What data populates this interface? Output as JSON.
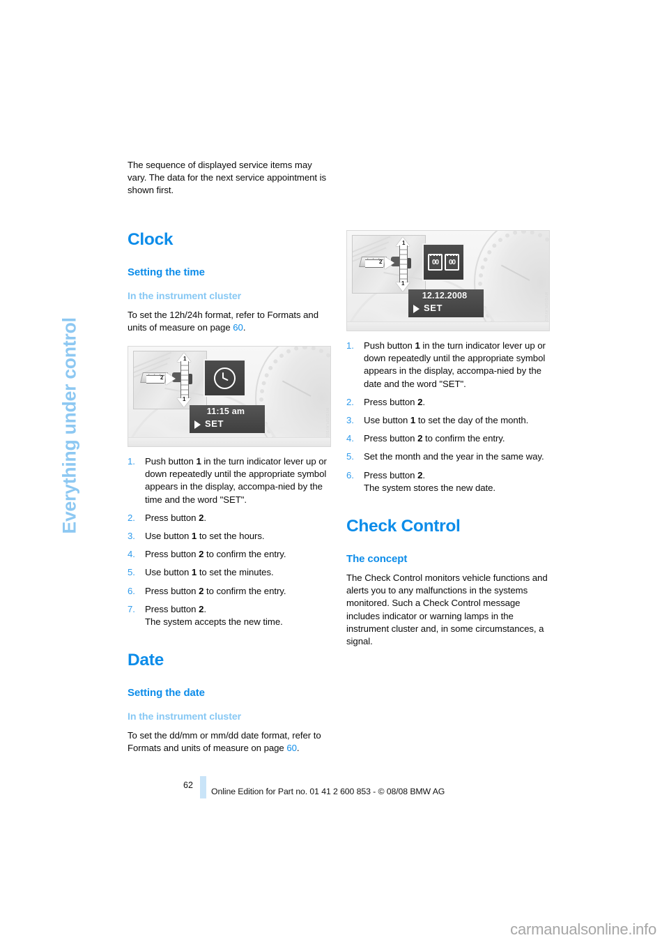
{
  "chapter_tab": {
    "label": "Everything under control"
  },
  "colors": {
    "heading_blue": "#0C8CE9",
    "subheading_light_blue": "#87C8F4",
    "chapter_tab_blue": "#8DC8F2",
    "footer_bar_blue": "#C9E4F8"
  },
  "left_column": {
    "intro_paragraph": "The sequence of displayed service items may vary. The data for the next service appointment is shown first.",
    "clock_heading": "Clock",
    "setting_the_time_heading": "Setting the time",
    "instrument_cluster_heading": "In the instrument cluster",
    "format_paragraph_before": "To set the 12h/24h format, refer to Formats and units of measure on page ",
    "format_page_ref": "60",
    "format_paragraph_after": ".",
    "figure": {
      "caption_credit": "MYDISPLAY001",
      "display_value": "11:15 am",
      "display_set_label": "SET",
      "arrow_label_1": "1",
      "arrow_label_2": "2",
      "icon": "clock-icon"
    },
    "steps": [
      {
        "text_parts": [
          {
            "t": "Push button "
          },
          {
            "t": "1",
            "b": true
          },
          {
            "t": " in the turn indicator lever up or down repeatedly until the appropriate symbol appears in the display, accompa‑nied by the time and the word \"SET\"."
          }
        ]
      },
      {
        "text_parts": [
          {
            "t": "Press button "
          },
          {
            "t": "2",
            "b": true
          },
          {
            "t": "."
          }
        ]
      },
      {
        "text_parts": [
          {
            "t": "Use button "
          },
          {
            "t": "1",
            "b": true
          },
          {
            "t": " to set the hours."
          }
        ]
      },
      {
        "text_parts": [
          {
            "t": "Press button "
          },
          {
            "t": "2",
            "b": true
          },
          {
            "t": " to confirm the entry."
          }
        ]
      },
      {
        "text_parts": [
          {
            "t": "Use button "
          },
          {
            "t": "1",
            "b": true
          },
          {
            "t": " to set the minutes."
          }
        ]
      },
      {
        "text_parts": [
          {
            "t": "Press button "
          },
          {
            "t": "2",
            "b": true
          },
          {
            "t": " to confirm the entry."
          }
        ]
      },
      {
        "text_parts": [
          {
            "t": "Press button "
          },
          {
            "t": "2",
            "b": true
          },
          {
            "t": "."
          }
        ],
        "sub": "The system accepts the new time."
      }
    ],
    "date_heading": "Date",
    "setting_the_date_heading": "Setting the date",
    "date_cluster_heading": "In the instrument cluster",
    "date_format_paragraph_before": "To set the dd/mm or mm/dd date format, refer to Formats and units of measure on page ",
    "date_format_page_ref": "60",
    "date_format_paragraph_after": "."
  },
  "right_column": {
    "figure": {
      "caption_credit": "MYDISPLAY002",
      "display_value": "12.12.2008",
      "display_set_label": "SET",
      "arrow_label_1": "1",
      "arrow_label_2": "2",
      "icon": "calendar-icon",
      "icon_digits_left": "00",
      "icon_digits_right": "00"
    },
    "steps": [
      {
        "text_parts": [
          {
            "t": "Push button "
          },
          {
            "t": "1",
            "b": true
          },
          {
            "t": " in the turn indicator lever up or down repeatedly until the appropriate symbol appears in the display, accompa‑nied by the date and the word \"SET\"."
          }
        ]
      },
      {
        "text_parts": [
          {
            "t": "Press button "
          },
          {
            "t": "2",
            "b": true
          },
          {
            "t": "."
          }
        ]
      },
      {
        "text_parts": [
          {
            "t": "Use button "
          },
          {
            "t": "1",
            "b": true
          },
          {
            "t": " to set the day of the month."
          }
        ]
      },
      {
        "text_parts": [
          {
            "t": "Press button "
          },
          {
            "t": "2",
            "b": true
          },
          {
            "t": " to confirm the entry."
          }
        ]
      },
      {
        "text_parts": [
          {
            "t": "Set the month and the year in the same way."
          }
        ]
      },
      {
        "text_parts": [
          {
            "t": "Press button "
          },
          {
            "t": "2",
            "b": true
          },
          {
            "t": "."
          }
        ],
        "sub": "The system stores the new date."
      }
    ],
    "check_control_heading": "Check Control",
    "the_concept_heading": "The concept",
    "concept_paragraph": "The Check Control monitors vehicle functions and alerts you to any malfunctions in the systems monitored. Such a Check Control message includes indicator or warning lamps in the instrument cluster and, in some circumstances, a signal."
  },
  "footer": {
    "page_number": "62",
    "credit": "Online Edition for Part no. 01 41 2 600 853 - © 08/08 BMW AG"
  },
  "watermark": {
    "text": "carmanualsonline.info"
  }
}
